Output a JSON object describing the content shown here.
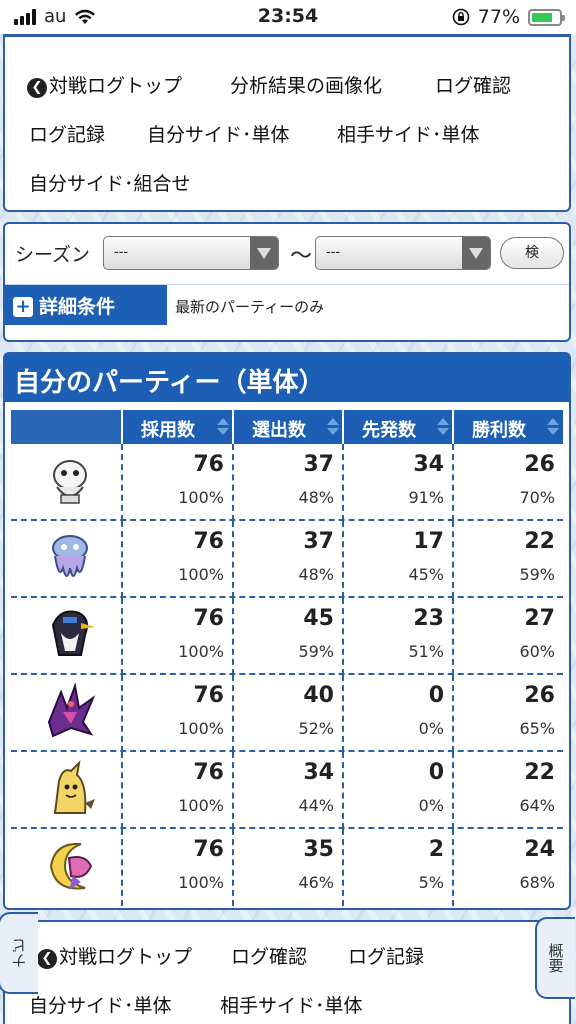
{
  "status_bar": {
    "carrier": "au",
    "time": "23:54",
    "battery_percent": "77%"
  },
  "top_nav": {
    "links": [
      "対戦ログトップ",
      "分析結果の画像化",
      "ログ確認",
      "ログ記録",
      "自分サイド･単体",
      "相手サイド･単体",
      "自分サイド･組合せ"
    ]
  },
  "filter": {
    "season_label": "シーズン",
    "season_from": "---",
    "tilde": "〜",
    "season_to": "---",
    "search_button": "検",
    "detail_label": "詳細条件",
    "detail_value": "最新のパーティーのみ"
  },
  "party": {
    "title": "自分のパーティー（単体）",
    "columns": [
      "採用数",
      "選出数",
      "先発数",
      "勝利数"
    ],
    "rows": [
      {
        "pokemon": "white-ghost-pokemon",
        "adopt": "76",
        "adopt_pct": "100%",
        "picked": "37",
        "picked_pct": "48%",
        "lead": "34",
        "lead_pct": "91%",
        "wins": "26",
        "wins_pct": "70%"
      },
      {
        "pokemon": "jellyfish-pokemon",
        "adopt": "76",
        "adopt_pct": "100%",
        "picked": "37",
        "picked_pct": "48%",
        "lead": "17",
        "lead_pct": "45%",
        "wins": "22",
        "wins_pct": "59%"
      },
      {
        "pokemon": "crow-pokemon",
        "adopt": "76",
        "adopt_pct": "100%",
        "picked": "45",
        "picked_pct": "59%",
        "lead": "23",
        "lead_pct": "51%",
        "wins": "27",
        "wins_pct": "60%"
      },
      {
        "pokemon": "purple-dragon-pokemon",
        "adopt": "76",
        "adopt_pct": "100%",
        "picked": "40",
        "picked_pct": "52%",
        "lead": "0",
        "lead_pct": "0%",
        "wins": "26",
        "wins_pct": "65%"
      },
      {
        "pokemon": "disguise-pokemon",
        "adopt": "76",
        "adopt_pct": "100%",
        "picked": "34",
        "picked_pct": "44%",
        "lead": "0",
        "lead_pct": "0%",
        "wins": "22",
        "wins_pct": "64%"
      },
      {
        "pokemon": "crescent-pokemon",
        "adopt": "76",
        "adopt_pct": "100%",
        "picked": "35",
        "picked_pct": "46%",
        "lead": "2",
        "lead_pct": "5%",
        "wins": "24",
        "wins_pct": "68%"
      }
    ]
  },
  "bottom_nav": {
    "links": [
      "対戦ログトップ",
      "ログ確認",
      "ログ記録",
      "自分サイド･単体",
      "相手サイド･単体"
    ]
  },
  "side_tabs": {
    "left": "ナビ",
    "right": "概要"
  }
}
